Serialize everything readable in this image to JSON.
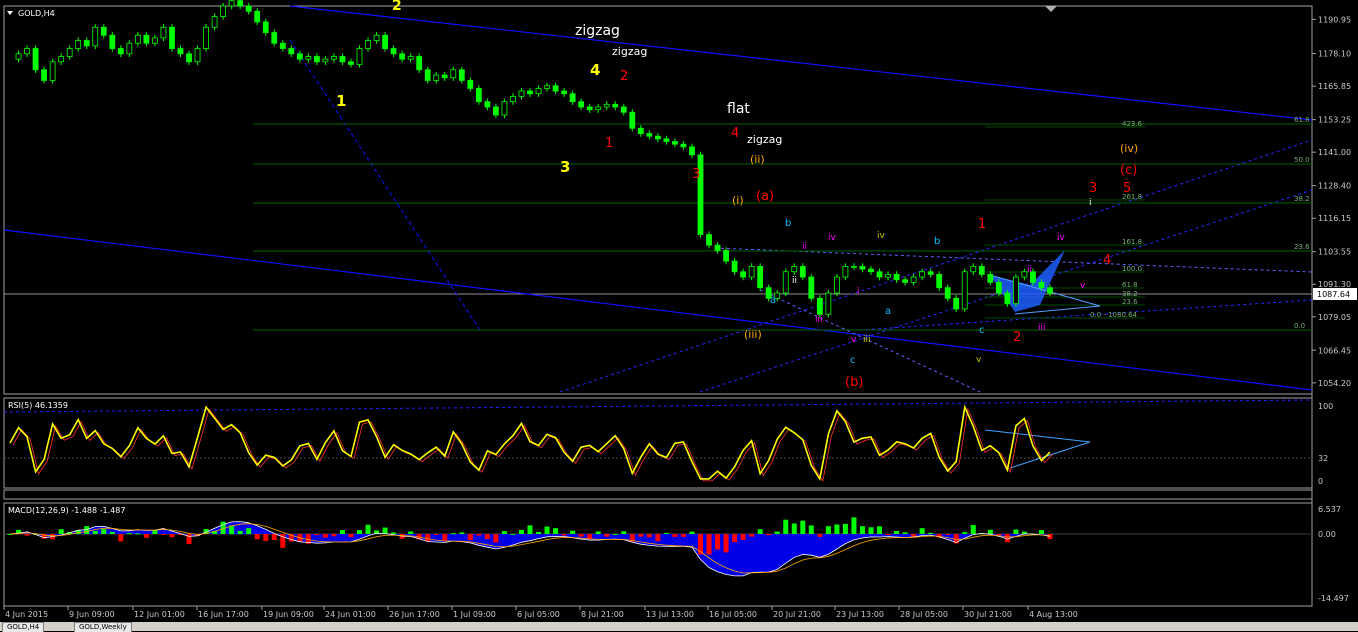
{
  "window": {
    "symbol_title": "GOLD,H4"
  },
  "tabs": [
    "GOLD,H4",
    "GOLD,Weekly"
  ],
  "colors": {
    "bg": "#000000",
    "grid": "#ffffff",
    "bull_candle": "#00ff00",
    "bear_candle": "#00ff00",
    "channel": "#0000ff",
    "fib": "#008000",
    "rsi_line": "#ffff00",
    "macd_pos": "#00ff00",
    "macd_neg": "#ff0000",
    "macd_fill": "#0000ff",
    "wave_yellow": "#ffff00",
    "wave_red": "#ff0000",
    "wave_white": "#ffffff",
    "wave_orange": "#ffa500"
  },
  "price_panel": {
    "current_price": "1087.64",
    "y_ticks": [
      "1190.95",
      "1178.10",
      "1165.85",
      "1153.25",
      "1141.00",
      "1128.40",
      "1116.15",
      "1103.55",
      "1091.30",
      "1079.05",
      "1066.45",
      "1054.20"
    ],
    "fib_labels_right": [
      "61.8",
      "50.0",
      "38.2",
      "23.6",
      "0.0"
    ],
    "fib_labels_inner": [
      "423.6",
      "261.8",
      "161.8",
      "100.0",
      "61.8",
      "38.2",
      "23.6",
      "0.0 - 1080.64"
    ],
    "annotations": [
      {
        "text": "zigzag",
        "color": "#ffffff"
      },
      {
        "text": "zigzag",
        "color": "#ffffff"
      },
      {
        "text": "flat",
        "color": "#ffffff"
      },
      {
        "text": "zigzag",
        "color": "#ffffff"
      },
      {
        "text": "2",
        "color": "#ffff00"
      },
      {
        "text": "1",
        "color": "#ffff00"
      },
      {
        "text": "4",
        "color": "#ffff00"
      },
      {
        "text": "3",
        "color": "#ffff00"
      },
      {
        "text": "2",
        "color": "#ff0000"
      },
      {
        "text": "1",
        "color": "#ff0000"
      },
      {
        "text": "3",
        "color": "#ff0000"
      },
      {
        "text": "4",
        "color": "#ff0000"
      },
      {
        "text": "(ii)",
        "color": "#ffa500"
      },
      {
        "text": "(i)",
        "color": "#ffa500"
      },
      {
        "text": "(a)",
        "color": "#ff0000"
      },
      {
        "text": "(iii)",
        "color": "#ffa500"
      },
      {
        "text": "(b)",
        "color": "#ff0000"
      },
      {
        "text": "(iv)",
        "color": "#ffa500"
      },
      {
        "text": "(c)",
        "color": "#ff0000"
      },
      {
        "text": "3",
        "color": "#ff0000"
      },
      {
        "text": "5",
        "color": "#ff0000"
      },
      {
        "text": "4",
        "color": "#ff0000"
      },
      {
        "text": "1",
        "color": "#ff0000"
      },
      {
        "text": "2",
        "color": "#ff0000"
      },
      {
        "text": "a",
        "color": "#00bfff"
      },
      {
        "text": "b",
        "color": "#00bfff"
      },
      {
        "text": "c",
        "color": "#00bfff"
      },
      {
        "text": "a",
        "color": "#00bfff"
      },
      {
        "text": "b",
        "color": "#00bfff"
      },
      {
        "text": "c",
        "color": "#00bfff"
      },
      {
        "text": "ii",
        "color": "#ff00ff"
      },
      {
        "text": "iii",
        "color": "#ff00ff"
      },
      {
        "text": "iv",
        "color": "#ff00ff"
      },
      {
        "text": "v",
        "color": "#ff00ff"
      },
      {
        "text": "i",
        "color": "#ff00ff"
      },
      {
        "text": "ii",
        "color": "#ff00ff"
      },
      {
        "text": "iii",
        "color": "#ff00ff"
      },
      {
        "text": "iv",
        "color": "#ff00ff"
      },
      {
        "text": "v",
        "color": "#ff00ff"
      },
      {
        "text": "i",
        "color": "#ffffff"
      },
      {
        "text": "ii",
        "color": "#ffffff"
      },
      {
        "text": "iii",
        "color": "#c8c800"
      },
      {
        "text": "iv",
        "color": "#c8c800"
      },
      {
        "text": "v",
        "color": "#c8c800"
      }
    ]
  },
  "rsi_panel": {
    "title": "RSI(5) 46.1359",
    "y_ticks": [
      "100",
      "32",
      "0"
    ]
  },
  "macd_panel": {
    "title": "MACD(12,26,9) -1.488 -1.487",
    "y_ticks": [
      "6.537",
      "0.00",
      "-14.497"
    ]
  },
  "x_axis": [
    "4 Jun 2015",
    "9 Jun 09:00",
    "12 Jun 01:00",
    "16 Jun 17:00",
    "19 Jun 09:00",
    "24 Jun 01:00",
    "26 Jun 17:00",
    "1 Jul 09:00",
    "6 Jul 05:00",
    "8 Jul 21:00",
    "13 Jul 13:00",
    "16 Jul 05:00",
    "20 Jul 21:00",
    "23 Jul 13:00",
    "28 Jul 05:00",
    "30 Jul 21:00",
    "4 Aug 13:00"
  ],
  "chart_data": {
    "type": "line",
    "title": "GOLD,H4",
    "xlabel": "",
    "ylabel": "",
    "ylim": [
      1050,
      1196
    ],
    "series": [
      {
        "values": [
          1176,
          1178,
          1180,
          1172,
          1168,
          1175,
          1177,
          1180,
          1183,
          1181,
          1188,
          1185,
          1180,
          1178,
          1182,
          1185,
          1182,
          1184,
          1188,
          1180,
          1178,
          1175,
          1180,
          1188,
          1192,
          1196,
          1198,
          1196,
          1194,
          1190,
          1186,
          1182,
          1180,
          1178,
          1176,
          1177,
          1175,
          1176,
          1177,
          1175,
          1174,
          1180,
          1183,
          1185,
          1180,
          1178,
          1176,
          1177,
          1172,
          1168,
          1170,
          1169,
          1172,
          1168,
          1165,
          1160,
          1158,
          1155,
          1160,
          1162,
          1164,
          1163,
          1165,
          1166,
          1164,
          1163,
          1160,
          1158,
          1157,
          1158,
          1159,
          1158,
          1156,
          1150,
          1148,
          1147,
          1146,
          1145,
          1144,
          1143,
          1140,
          1110,
          1106,
          1104,
          1100,
          1096,
          1094,
          1098,
          1090,
          1086,
          1088,
          1096,
          1098,
          1094,
          1086,
          1080,
          1088,
          1094,
          1098,
          1098,
          1097,
          1096,
          1094,
          1095,
          1093,
          1092,
          1094,
          1096,
          1095,
          1090,
          1086,
          1082,
          1096,
          1098,
          1095,
          1092,
          1088,
          1084,
          1094,
          1096,
          1092,
          1090,
          1088
        ]
      }
    ]
  }
}
